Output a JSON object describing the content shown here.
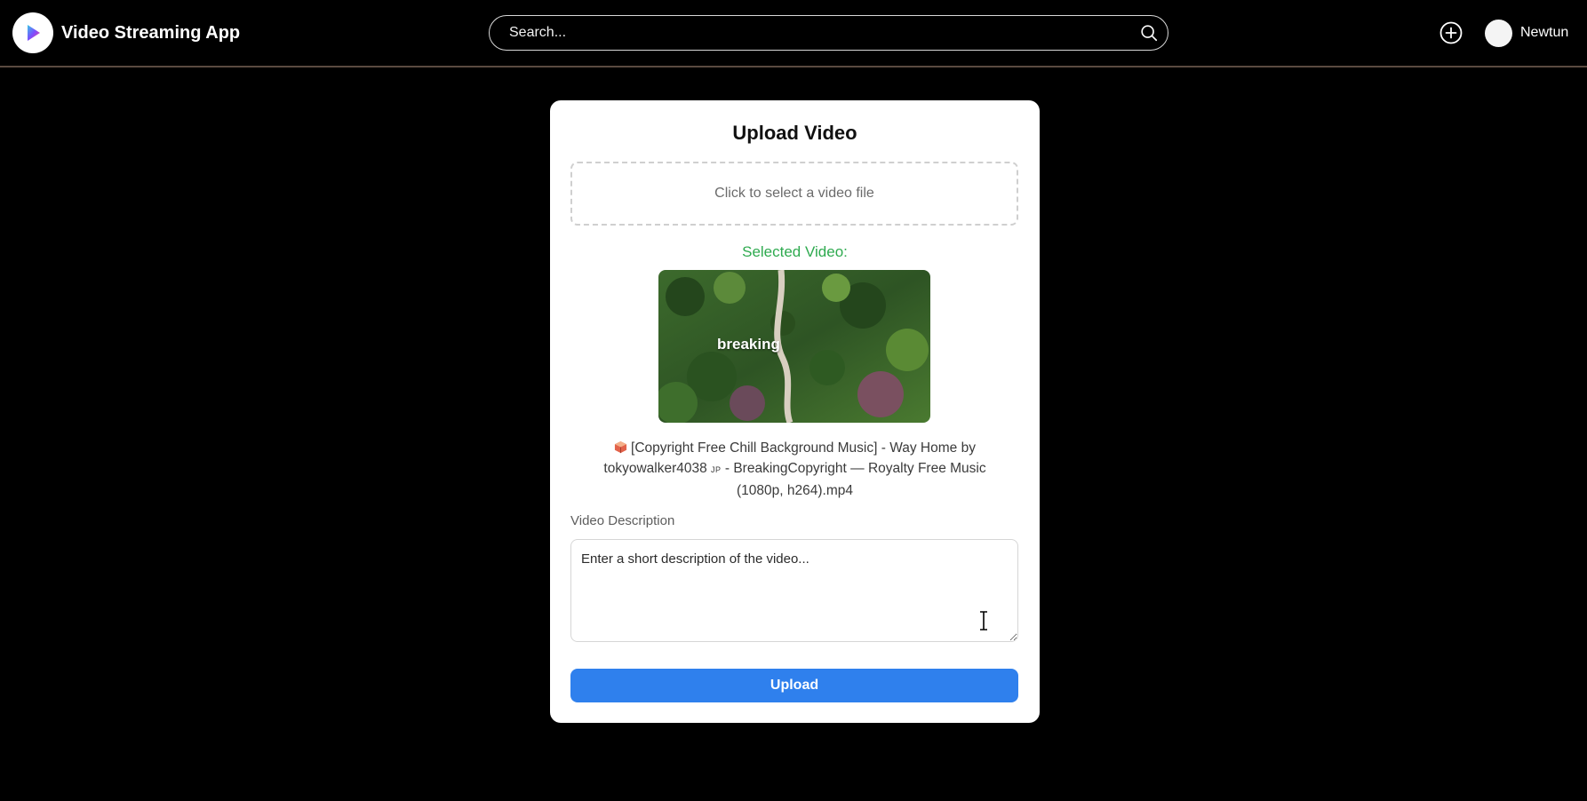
{
  "header": {
    "app_title": "Video Streaming App",
    "logo_icon": "play-logo-icon",
    "search": {
      "placeholder": "Search...",
      "value": ""
    },
    "search_icon": "search-icon",
    "add_icon": "plus-circle-icon",
    "user": {
      "name": "Newtun",
      "avatar_icon": "avatar"
    }
  },
  "upload_card": {
    "title": "Upload Video",
    "file_drop_label": "Click to select a video file",
    "selected_label": "Selected Video:",
    "thumbnail_caption": "breaking",
    "file_name": {
      "part1": "[Copyright Free Chill Background Music] - Way Home by tokyowalker4038",
      "jp": "JP",
      "part2": "- BreakingCopyright — Royalty Free Music (1080p, h264).mp4"
    },
    "description": {
      "label": "Video Description",
      "placeholder": "Enter a short description of the video...",
      "value": ""
    },
    "upload_button": "Upload"
  },
  "colors": {
    "accent": "#2f80ed",
    "success": "#2eaa4f",
    "background": "#000000",
    "card": "#ffffff"
  }
}
